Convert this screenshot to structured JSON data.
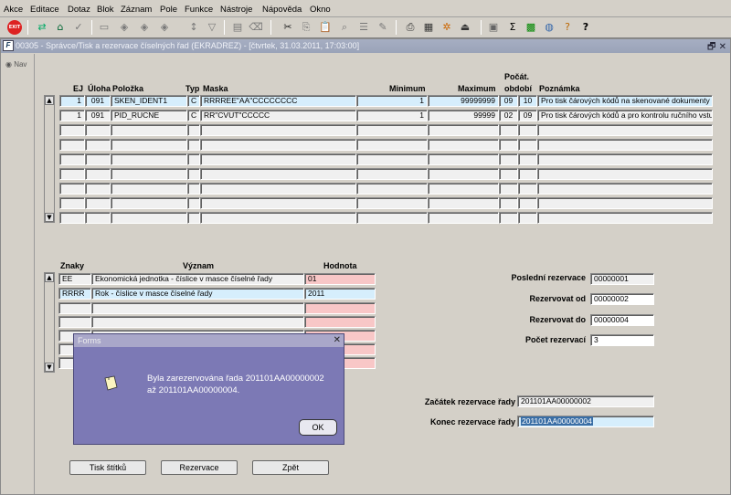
{
  "menu": {
    "items": [
      {
        "label": "Akce"
      },
      {
        "label": "Editace"
      },
      {
        "label": "Dotaz"
      },
      {
        "label": "Blok"
      },
      {
        "label": "Záznam"
      },
      {
        "label": "Pole"
      },
      {
        "label": "Funkce"
      },
      {
        "label": "Nástroje"
      },
      {
        "label": "Nápověda"
      },
      {
        "label": "Okno"
      }
    ]
  },
  "window": {
    "title": "00305 - Správce/Tisk a rezervace číselných řad (EKRADREZ) - [čtvrtek, 31.03.2011, 17:03:00]",
    "icon_text": "F",
    "controls": "🗗 ✕"
  },
  "nav": {
    "label": "Nav"
  },
  "top_table": {
    "headers": {
      "ej": "EJ",
      "uloha": "Úloha",
      "polozka": "Položka",
      "typ": "Typ",
      "maska": "Maska",
      "minimum": "Minimum",
      "maximum": "Maximum",
      "pocat_obdobi_1": "Počát.",
      "pocat_obdobi_2": "období",
      "poznamka": "Poznámka"
    },
    "rows": [
      {
        "ej": "1",
        "uloha": "091",
        "polozka": "SKEN_IDENT1",
        "typ": "C",
        "maska": "RRRREE\"AA\"CCCCCCCC",
        "minimum": "1",
        "maximum": "99999999",
        "pocat": "09",
        "obdobi": "10",
        "poznamka": "Pro tisk čárových kódů na skenované dokumenty"
      },
      {
        "ej": "1",
        "uloha": "091",
        "polozka": "PID_RUCNE",
        "typ": "C",
        "maska": "RR\"CVUT\"CCCCC",
        "minimum": "1",
        "maximum": "99999",
        "pocat": "02",
        "obdobi": "09",
        "poznamka": "Pro tisk čárových kódů a pro kontrolu ručního vstupu"
      }
    ]
  },
  "bottom_table": {
    "headers": {
      "znaky": "Znaky",
      "vyznam": "Význam",
      "hodnota": "Hodnota"
    },
    "rows": [
      {
        "znaky": "EE",
        "vyznam": "Ekonomická jednotka - číslice v masce číselné řady",
        "hodnota": "01"
      },
      {
        "znaky": "RRRR",
        "vyznam": "Rok - číslice v masce číselné řady",
        "hodnota": "2011"
      }
    ]
  },
  "reservation": {
    "posledni_label": "Poslední rezervace",
    "posledni_value": "00000001",
    "od_label": "Rezervovat od",
    "od_value": "00000002",
    "do_label": "Rezervovat do",
    "do_value": "00000004",
    "pocet_label": "Počet rezervací",
    "pocet_value": "3",
    "zacatek_label": "Začátek rezervace řady",
    "zacatek_value": "201101AA00000002",
    "konec_label": "Konec rezervace řady",
    "konec_value": "201101AA00000004"
  },
  "buttons": {
    "tisk": "Tisk štítků",
    "rezervace": "Rezervace",
    "zpet": "Zpět"
  },
  "dialog": {
    "title": "Forms",
    "message": "Byla zarezervována řada 201101AA00000002 až 201101AA00000004.",
    "ok": "OK"
  }
}
